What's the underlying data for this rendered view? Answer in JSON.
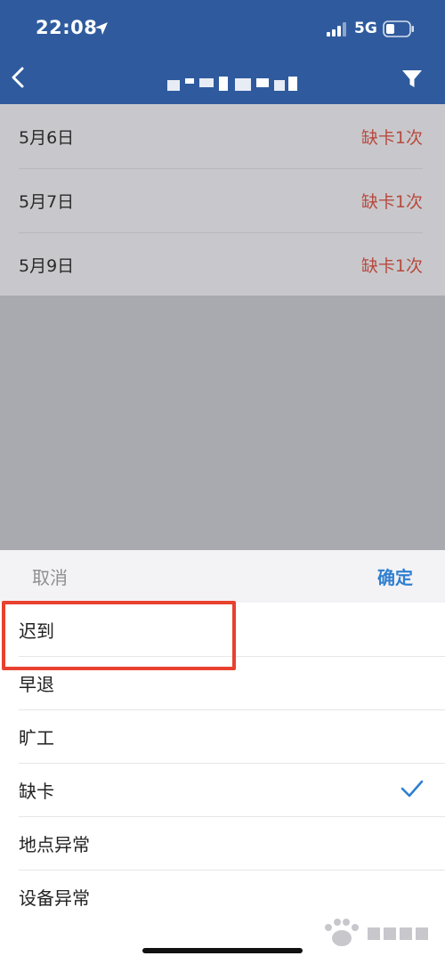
{
  "status_bar": {
    "time": "22:08",
    "network": "5G"
  },
  "records": [
    {
      "date": "5月6日",
      "status": "缺卡1次"
    },
    {
      "date": "5月7日",
      "status": "缺卡1次"
    },
    {
      "date": "5月9日",
      "status": "缺卡1次"
    }
  ],
  "sheet": {
    "cancel_label": "取消",
    "confirm_label": "确定",
    "options": [
      {
        "label": "迟到"
      },
      {
        "label": "早退"
      },
      {
        "label": "旷工"
      },
      {
        "label": "缺卡",
        "selected": true
      },
      {
        "label": "地点异常"
      },
      {
        "label": "设备异常"
      }
    ]
  },
  "colors": {
    "header": "#2f5b9e",
    "status_red": "#b84a3e",
    "confirm_blue": "#2f7fd1",
    "highlight": "#e8412f"
  }
}
